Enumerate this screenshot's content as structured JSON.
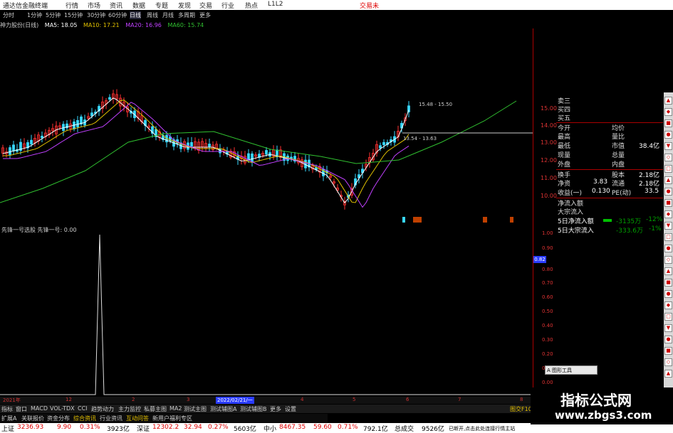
{
  "titlebar": {
    "app_name": "通达信金融终端",
    "menu": [
      "行情",
      "市场",
      "资讯",
      "数据",
      "专题",
      "发现",
      "交易",
      "行业",
      "热点",
      "L1L2"
    ],
    "trade_button": "交易未"
  },
  "periods": [
    "分时",
    "1分钟",
    "5分钟",
    "15分钟",
    "30分钟",
    "60分钟",
    "日线",
    "周线",
    "月线",
    "多周期",
    "更多"
  ],
  "active_period": "日线",
  "ma_legend": {
    "stock": "神力股份(日线)",
    "ma5": "MA5: 18.05",
    "ma10": "MA10: 17.21",
    "ma20": "MA20: 16.96",
    "ma60": "MA60: 15.74"
  },
  "main_annotations": {
    "high": "15.48 - 15.50",
    "mid": "13.54 - 13.63"
  },
  "main_axis_labels": [
    "15.00",
    "14.00",
    "13.00",
    "12.00",
    "11.00",
    "10.00"
  ],
  "info_panel": {
    "rows": [
      {
        "l": "卖三",
        "r": ""
      },
      {
        "l": "买四",
        "r": ""
      },
      {
        "l": "买五",
        "r": ""
      },
      {
        "l": "今开",
        "r": "均价"
      },
      {
        "l": "最高",
        "r": "量比"
      },
      {
        "l": "最低",
        "r": "市值",
        "v": "38.4亿"
      },
      {
        "l": "现量",
        "r": "总量"
      },
      {
        "l": "外盘",
        "r": "内盘"
      },
      {
        "l": "换手",
        "r": "股本",
        "v": "2.18亿"
      },
      {
        "l": "净资",
        "lv": "3.83",
        "r": "流通",
        "v": "2.18亿"
      },
      {
        "l": "收益(一)",
        "lv": "0.130",
        "r": "PE(动)",
        "v": "33.5"
      }
    ],
    "flow": [
      {
        "label": "净流入额",
        "value": "",
        "pct": ""
      },
      {
        "label": "大宗流入",
        "value": "",
        "pct": ""
      },
      {
        "label": "5日净流入额",
        "value": "-3135万",
        "pct": "-12%"
      },
      {
        "label": "5日大宗流入",
        "value": "-333.6万",
        "pct": "-1%"
      }
    ]
  },
  "indicator_legend": "先锋一号选股  先锋一号: 0.00",
  "ind_axis_labels": [
    "1.00",
    "0.90",
    "0.80",
    "0.70",
    "0.60",
    "0.50",
    "0.40",
    "0.30",
    "0.20",
    "0.10",
    "0.00"
  ],
  "ind_marker": "0.82",
  "date_axis": [
    "2021年",
    "12",
    "2",
    "3",
    "2022/02/21/一",
    "4",
    "5",
    "6",
    "7",
    "8"
  ],
  "tabs": [
    "指标",
    "窗口",
    "MACD",
    "VOL-TDX",
    "CCI",
    "趋势动力",
    "主力监控",
    "私募主图",
    "MA2",
    "测试主图",
    "测试辅图A",
    "测试辅图B",
    "更多",
    "设置"
  ],
  "subtabs": [
    "扩展A",
    "关联报价",
    "资金分布",
    "综合资讯",
    "行业资讯",
    "互动问答",
    "新用户福利专区"
  ],
  "highlight_subtabs": [
    "综合资讯",
    "互动问答"
  ],
  "status": {
    "sh_label": "上证",
    "sh_val": "3236.93",
    "sh_chg": "9.90",
    "sh_pct": "0.31%",
    "sh_amt": "3923亿",
    "sz_label": "深证",
    "sz_val": "12302.2",
    "sz_chg": "32.94",
    "sz_pct": "0.27%",
    "sz_amt": "5603亿",
    "zx_label": "中小",
    "zx_val": "8467.35",
    "zx_chg": "59.60",
    "zx_pct": "0.71%",
    "zx_amt": "792.1亿",
    "total_label": "总成交",
    "total_val": "9526亿",
    "notice": "已断开,点击此处连接行情主站"
  },
  "bottom_right": "图交F10",
  "tool_popup": "A 图形工具",
  "watermark": {
    "line1": "指标公式网",
    "line2": "www.zbgs3.com"
  },
  "colors": {
    "up": "#ff3030",
    "down": "#38d8ff",
    "ma5": "#ffffff",
    "ma10": "#e0c000",
    "ma20": "#c040ff",
    "ma60": "#30c030"
  }
}
